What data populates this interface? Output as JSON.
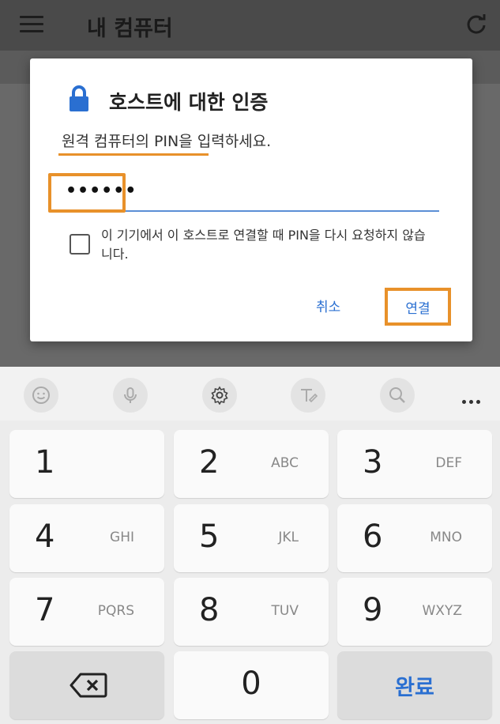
{
  "app": {
    "title": "내 컴퓨터"
  },
  "dialog": {
    "title": "호스트에 대한 인증",
    "message": "원격 컴퓨터의 PIN을 입력하세요.",
    "pin_value": "••••••",
    "checkbox_label": "이 기기에서 이 호스트로 연결할 때 PIN을 다시 요청하지 않습니다.",
    "checkbox_checked": false,
    "cancel_label": "취소",
    "connect_label": "연결"
  },
  "keyboard": {
    "toolbar_icons": [
      "emoji-icon",
      "mic-icon",
      "settings-icon",
      "handwriting-icon",
      "search-icon",
      "more-icon"
    ],
    "keys": [
      {
        "num": "1",
        "letters": ""
      },
      {
        "num": "2",
        "letters": "ABC"
      },
      {
        "num": "3",
        "letters": "DEF"
      },
      {
        "num": "4",
        "letters": "GHI"
      },
      {
        "num": "5",
        "letters": "JKL"
      },
      {
        "num": "6",
        "letters": "MNO"
      },
      {
        "num": "7",
        "letters": "PQRS"
      },
      {
        "num": "8",
        "letters": "TUV"
      },
      {
        "num": "9",
        "letters": "WXYZ"
      },
      {
        "num": "0",
        "letters": ""
      }
    ],
    "done_label": "완료"
  },
  "colors": {
    "accent": "#2a6fd1",
    "highlight": "#e8912a",
    "lock": "#2a6fd1"
  }
}
